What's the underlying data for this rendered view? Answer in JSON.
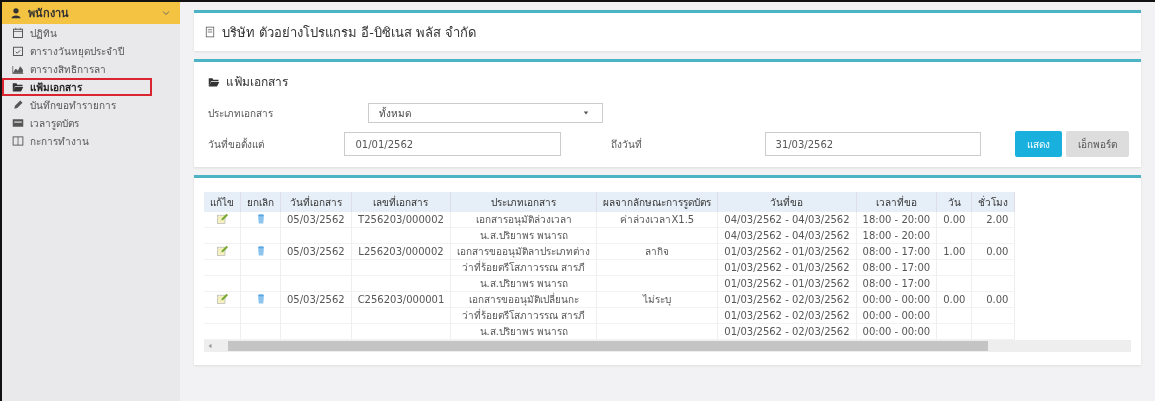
{
  "sidebar": {
    "title": "พนักงาน",
    "expanded": true,
    "items": [
      {
        "label": "ปฏิทิน",
        "selected": false
      },
      {
        "label": "ตารางวันหยุดประจำปี",
        "selected": false
      },
      {
        "label": "ตารางสิทธิการลา",
        "selected": false
      },
      {
        "label": "แฟ้มเอกสาร",
        "selected": true
      },
      {
        "label": "บันทึกขอทำรายการ",
        "selected": false
      },
      {
        "label": "เวลารูดบัตร",
        "selected": false
      },
      {
        "label": "กะการทำงาน",
        "selected": false
      }
    ]
  },
  "company": {
    "title": "บริษัท ตัวอย่างโปรแกรม อี-บิซิเนส พลัส จำกัด"
  },
  "filter": {
    "title": "แฟ้มเอกสาร",
    "type_label": "ประเภทเอกสาร",
    "type_value": "ทั้งหมด",
    "from_label": "วันที่ขอตั้งแต่",
    "from_value": "01/01/2562",
    "to_label": "ถึงวันที่",
    "to_value": "31/03/2562",
    "buttons": [
      {
        "label": "แสดง",
        "kind": "primary"
      },
      {
        "label": "เอ็กพอร์ต",
        "kind": "default"
      }
    ]
  },
  "table": {
    "columns": [
      "แก้ไข",
      "ยกเลิก",
      "วันที่เอกสาร",
      "เลขที่เอกสาร",
      "ประเภทเอกสาร",
      "ผลจากลักษณะการรูดบัตร",
      "วันที่ขอ",
      "เวลาที่ขอ",
      "วัน",
      "ชั่วโมง"
    ],
    "rows": [
      {
        "kind": "main",
        "date": "05/03/2562",
        "number": "T256203/000002",
        "type": "เอกสารอนุมัติล่วงเวลา",
        "result": "ค่าล่วงเวลาX1.5",
        "requested": "04/03/2562 - 04/03/2562",
        "time": "18:00 - 20:00",
        "days": "0.00",
        "hours": "2.00"
      },
      {
        "kind": "sub",
        "type": "น.ส.ปริยาพร พนารถ",
        "requested": "04/03/2562 - 04/03/2562",
        "time": "18:00 - 20:00"
      },
      {
        "kind": "main",
        "date": "05/03/2562",
        "number": "L256203/000002",
        "type": "เอกสารขออนุมัติลาประเภทต่าง",
        "result": "ลากิจ",
        "requested": "01/03/2562 - 01/03/2562",
        "time": "08:00 - 17:00",
        "days": "1.00",
        "hours": "0.00"
      },
      {
        "kind": "sub",
        "type": "ว่าที่ร้อยตรีโสภาวรรณ สารภี",
        "requested": "01/03/2562 - 01/03/2562",
        "time": "08:00 - 17:00"
      },
      {
        "kind": "sub",
        "type": "น.ส.ปริยาพร พนารถ",
        "requested": "01/03/2562 - 01/03/2562",
        "time": "08:00 - 17:00"
      },
      {
        "kind": "main",
        "date": "05/03/2562",
        "number": "C256203/000001",
        "type": "เอกสารขออนุมัติเปลี่ยนกะ",
        "result": "ไม่ระบุ",
        "requested": "01/03/2562 - 02/03/2562",
        "time": "00:00 - 00:00",
        "days": "0.00",
        "hours": "0.00"
      },
      {
        "kind": "sub",
        "type": "ว่าที่ร้อยตรีโสภาวรรณ สารภี",
        "requested": "01/03/2562 - 02/03/2562",
        "time": "00:00 - 00:00"
      },
      {
        "kind": "sub",
        "type": "น.ส.ปริยาพร พนารถ",
        "requested": "01/03/2562 - 02/03/2562",
        "time": "00:00 - 00:00"
      }
    ]
  }
}
